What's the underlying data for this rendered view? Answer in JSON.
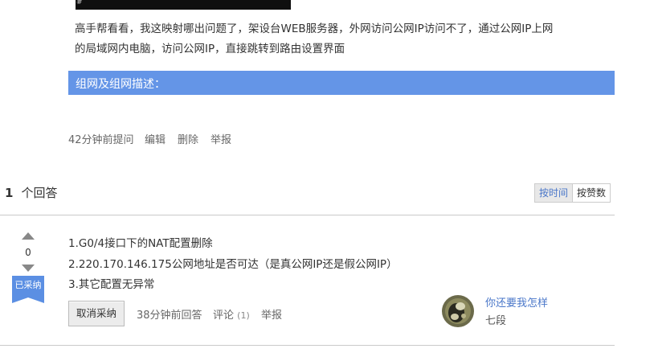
{
  "question": {
    "body_line1": "高手帮看看，我这映射哪出问题了，架设台WEB服务器，外网访问公网IP访问不了，通过公网IP上网",
    "body_line2": "的局域网内电脑，访问公网IP，直接跳转到路由设置界面",
    "section_title": "组网及组网描述：",
    "time": "42分钟前提问",
    "edit": "编辑",
    "delete": "删除",
    "report": "举报",
    "code_fragment": "#"
  },
  "answers_header": {
    "count": "1",
    "label": "个回答",
    "sort_by_time": "按时间",
    "sort_by_votes": "按赞数"
  },
  "answer": {
    "votes": "0",
    "accepted_label": "已采纳",
    "lines": [
      "1.G0/4接口下的NAT配置删除",
      "2.220.170.146.175公网地址是否可达（是真公网IP还是假公网IP）",
      "3.其它配置无异常"
    ],
    "cancel_accept": "取消采纳",
    "time": "38分钟前回答",
    "comment": "评论",
    "comment_count": "(1)",
    "report": "举报",
    "author_name": "你还要我怎样",
    "author_level": "七段"
  },
  "colors": {
    "section_bar": "#6495e7",
    "accepted_ribbon": "#5b8fe3",
    "link": "#4a77c9"
  }
}
